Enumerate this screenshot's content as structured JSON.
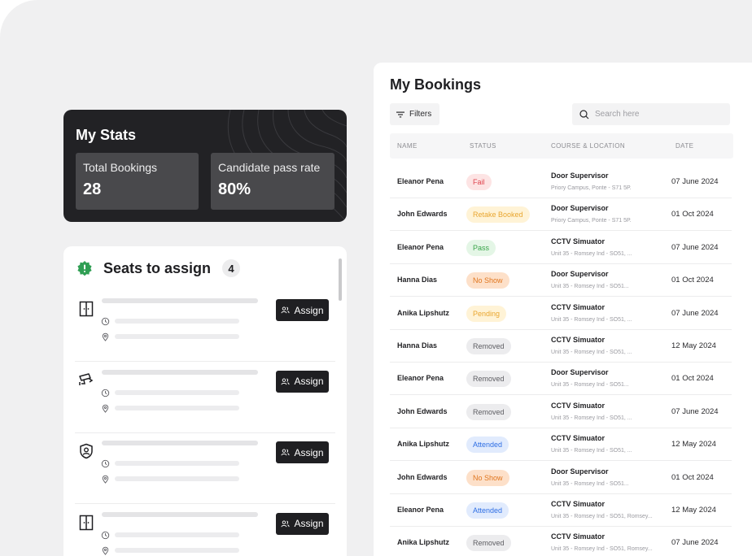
{
  "stats": {
    "title": "My Stats",
    "total_bookings_label": "Total Bookings",
    "total_bookings_value": "28",
    "pass_rate_label": "Candidate pass rate",
    "pass_rate_value": "80%"
  },
  "seats": {
    "title": "Seats to assign",
    "count": "4",
    "assign_label": "Assign",
    "rows": [
      {
        "icon": "door-icon"
      },
      {
        "icon": "cctv-camera-icon"
      },
      {
        "icon": "shield-user-icon"
      },
      {
        "icon": "door-icon"
      }
    ]
  },
  "bookings": {
    "title": "My Bookings",
    "filters_label": "Filters",
    "search_placeholder": "Search here",
    "columns": [
      "NAME",
      "STATUS",
      "COURSE & LOCATION",
      "DATE"
    ],
    "rows": [
      {
        "name": "Eleanor Pena",
        "status": "Fail",
        "course": "Door Supervisor",
        "location": "Priory Campus, Ponte - S71 5P.",
        "date": "07 June 2024"
      },
      {
        "name": "John Edwards",
        "status": "Retake Booked",
        "course": "Door Supervisor",
        "location": "Priory Campus, Ponte - S71 5P.",
        "date": "01 Oct 2024"
      },
      {
        "name": "Eleanor Pena",
        "status": "Pass",
        "course": "CCTV Simuator",
        "location": "Unit 35 - Romsey Ind - SO51, ...",
        "date": "07 June 2024"
      },
      {
        "name": "Hanna Dias",
        "status": "No Show",
        "course": "Door Supervisor",
        "location": "Unit 35 - Romsey Ind - SO51...",
        "date": "01 Oct 2024"
      },
      {
        "name": "Anika Lipshutz",
        "status": "Pending",
        "course": "CCTV Simuator",
        "location": "Unit 35 - Romsey Ind - SO51, ...",
        "date": "07 June 2024"
      },
      {
        "name": "Hanna Dias",
        "status": "Removed",
        "course": "CCTV Simuator",
        "location": "Unit 35 - Romsey Ind - SO51, ...",
        "date": "12 May 2024"
      },
      {
        "name": "Eleanor Pena",
        "status": "Removed",
        "course": "Door Supervisor",
        "location": "Unit 35 - Romsey Ind - SO51...",
        "date": "01 Oct 2024"
      },
      {
        "name": "John Edwards",
        "status": "Removed",
        "course": "CCTV Simuator",
        "location": "Unit 35 - Romsey Ind - SO51, ...",
        "date": "07 June 2024"
      },
      {
        "name": "Anika Lipshutz",
        "status": "Attended",
        "course": "CCTV Simuator",
        "location": "Unit 35 - Romsey Ind - SO51, ...",
        "date": "12 May 2024"
      },
      {
        "name": "John Edwards",
        "status": "No Show",
        "course": "Door Supervisor",
        "location": "Unit 35 - Romsey Ind - SO51...",
        "date": "01 Oct 2024"
      },
      {
        "name": "Eleanor Pena",
        "status": "Attended",
        "course": "CCTV Simuator",
        "location": "Unit 35 - Romsey Ind - SO51, Romsey...",
        "date": "12 May 2024"
      },
      {
        "name": "Anika Lipshutz",
        "status": "Removed",
        "course": "CCTV Simuator",
        "location": "Unit 35 - Romsey Ind - SO51, Romsey...",
        "date": "07 June 2024"
      }
    ]
  },
  "status_colors": {
    "Fail": {
      "bg": "#fde4e4",
      "fg": "#e0454f"
    },
    "Retake Booked": {
      "bg": "#fff3d6",
      "fg": "#e9a630"
    },
    "Pass": {
      "bg": "#e4f6e6",
      "fg": "#3aa54a"
    },
    "No Show": {
      "bg": "#fde0c9",
      "fg": "#e0761f"
    },
    "Pending": {
      "bg": "#fff3d6",
      "fg": "#e9a630"
    },
    "Removed": {
      "bg": "#ececee",
      "fg": "#5d5d62"
    },
    "Attended": {
      "bg": "#e1ebfd",
      "fg": "#2f6fe4"
    }
  },
  "colors": {
    "accent_dark": "#222225",
    "badge_green": "#2f9e53"
  }
}
